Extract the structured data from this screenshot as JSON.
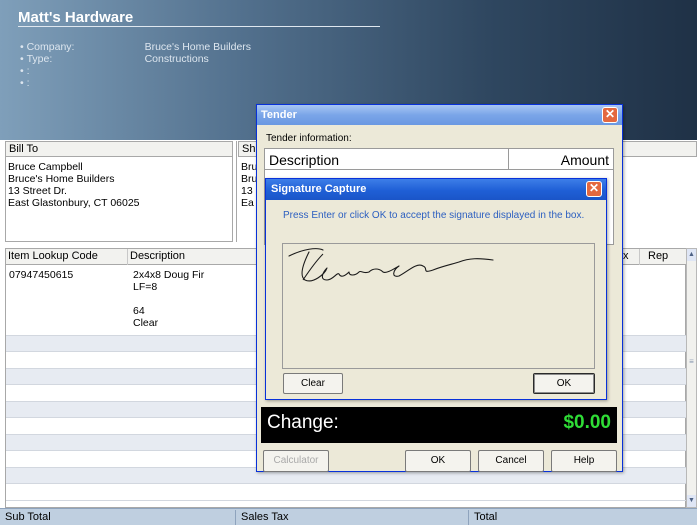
{
  "header": {
    "title": "Matt's Hardware",
    "info": [
      {
        "label": "Company:",
        "value": "Bruce's Home Builders"
      },
      {
        "label": "Type:",
        "value": "Constructions"
      },
      {
        "label": ":",
        "value": ""
      },
      {
        "label": ":",
        "value": ""
      }
    ]
  },
  "bill_to": {
    "heading": "Bill To",
    "lines": [
      "Bruce Campbell",
      "Bruce's Home Builders",
      "13 Street Dr.",
      "East Glastonbury, CT 06025"
    ]
  },
  "ship_to": {
    "heading": "Sh",
    "lines": [
      "Bru",
      "Bru",
      "13",
      "Ea"
    ]
  },
  "grid": {
    "columns": [
      "Item Lookup Code",
      "Description",
      "x",
      "Rep"
    ],
    "rows": [
      {
        "code": "07947450615",
        "description_lines": [
          "2x4x8 Doug Fir",
          "LF=8",
          "",
          "64",
          "Clear"
        ]
      }
    ]
  },
  "footer": {
    "sub_total": "Sub Total",
    "sales_tax": "Sales Tax",
    "total": "Total"
  },
  "tender": {
    "title": "Tender",
    "info_label": "Tender information:",
    "col_description": "Description",
    "col_amount": "Amount",
    "change_label": "Change:",
    "change_value": "$0.00",
    "buttons": {
      "calculator": "Calculator",
      "ok": "OK",
      "cancel": "Cancel",
      "help": "Help"
    }
  },
  "signature": {
    "title": "Signature Capture",
    "message": "Press Enter or click OK to accept the signature displayed in the box.",
    "clear": "Clear",
    "ok": "OK"
  },
  "colors": {
    "change_value": "#2fdc36",
    "title_bar": "#1f5fd6",
    "close": "#e4683f"
  }
}
